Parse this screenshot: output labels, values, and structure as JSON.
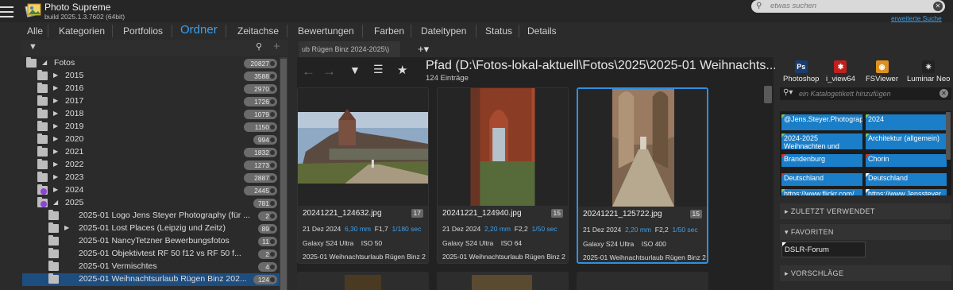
{
  "app": {
    "name": "Photo Supreme",
    "build": "build 2025.1.3.7602 (64bit)"
  },
  "search": {
    "placeholder": "etwas suchen",
    "advanced": "erweiterte Suche"
  },
  "tabs": [
    "Alle",
    "Kategorien",
    "Portfolios",
    "Ordner",
    "Zeitachse",
    "Bewertungen",
    "Farben",
    "Dateitypen",
    "Status",
    "Details"
  ],
  "active_tab": "Ordner",
  "tree": [
    {
      "label": "Fotos",
      "count": "20827",
      "level": 0,
      "expanded": true,
      "purple": false
    },
    {
      "label": "2015",
      "count": "3588",
      "level": 1,
      "expanded": false,
      "purple": false
    },
    {
      "label": "2016",
      "count": "2970",
      "level": 1,
      "expanded": false,
      "purple": false
    },
    {
      "label": "2017",
      "count": "1726",
      "level": 1,
      "expanded": false,
      "purple": false
    },
    {
      "label": "2018",
      "count": "1079",
      "level": 1,
      "expanded": false,
      "purple": false
    },
    {
      "label": "2019",
      "count": "1150",
      "level": 1,
      "expanded": false,
      "purple": false
    },
    {
      "label": "2020",
      "count": "994",
      "level": 1,
      "expanded": false,
      "purple": false
    },
    {
      "label": "2021",
      "count": "1832",
      "level": 1,
      "expanded": false,
      "purple": false
    },
    {
      "label": "2022",
      "count": "1273",
      "level": 1,
      "expanded": false,
      "purple": false
    },
    {
      "label": "2023",
      "count": "2887",
      "level": 1,
      "expanded": false,
      "purple": false
    },
    {
      "label": "2024",
      "count": "2445",
      "level": 1,
      "expanded": false,
      "purple": true
    },
    {
      "label": "2025",
      "count": "781",
      "level": 1,
      "expanded": true,
      "purple": true
    },
    {
      "label": "2025-01 Logo Jens Steyer Photography (für ...",
      "count": "2",
      "level": 2,
      "expanded": null,
      "purple": false
    },
    {
      "label": "2025-01 Lost Places (Leipzig und Zeitz)",
      "count": "89",
      "level": 2,
      "expanded": false,
      "purple": false
    },
    {
      "label": "2025-01 NancyTetzner Bewerbungsfotos",
      "count": "11",
      "level": 2,
      "expanded": null,
      "purple": false
    },
    {
      "label": "2025-01 Objektivtest RF 50 f12 vs RF 50 f...",
      "count": "2",
      "level": 2,
      "expanded": null,
      "purple": false
    },
    {
      "label": "2025-01 Vermischtes",
      "count": "4",
      "level": 2,
      "expanded": null,
      "purple": false
    },
    {
      "label": "2025-01 Weihnachtsurlaub Rügen Binz 202...",
      "count": "124",
      "level": 2,
      "expanded": null,
      "purple": false,
      "selected": true
    }
  ],
  "breadcrumb_tab": "ub Rügen Binz 2024-2025\\)",
  "path_title": "Pfad (D:\\Fotos-lokal-aktuell\\Fotos\\2025\\2025-01 Weihnachts...",
  "path_count": "124 Einträge",
  "cards": [
    {
      "filename": "20241221_124632.jpg",
      "badge": "17",
      "date": "21 Dez 2024",
      "focal": "6,30 mm",
      "aperture": "F1,7",
      "shutter": "1/180 sec",
      "camera": "Galaxy S24 Ultra",
      "iso": "ISO 50",
      "folder": "2025-01 Weihnachtsurlaub Rügen Binz 2"
    },
    {
      "filename": "20241221_124940.jpg",
      "badge": "15",
      "date": "21 Dez 2024",
      "focal": "2,20 mm",
      "aperture": "F2,2",
      "shutter": "1/50 sec",
      "camera": "Galaxy S24 Ultra",
      "iso": "ISO 64",
      "folder": "2025-01 Weihnachtsurlaub Rügen Binz 2"
    },
    {
      "filename": "20241221_125722.jpg",
      "badge": "15",
      "date": "21 Dez 2024",
      "focal": "2,20 mm",
      "aperture": "F2,2",
      "shutter": "1/50 sec",
      "camera": "Galaxy S24 Ultra",
      "iso": "ISO 400",
      "folder": "2025-01 Weihnachtsurlaub Rügen Binz 2"
    }
  ],
  "apps": [
    {
      "label": "Photoshop",
      "icon": "photoshop-icon",
      "color": "#1b3c6e",
      "glyph": "Ps"
    },
    {
      "label": "i_view64",
      "icon": "irfanview-icon",
      "color": "#c0201c",
      "glyph": "✱"
    },
    {
      "label": "FSViewer",
      "icon": "fsviewer-icon",
      "color": "#e09020",
      "glyph": "◉"
    },
    {
      "label": "Luminar Neo",
      "icon": "luminar-icon",
      "color": "#222",
      "glyph": "✳"
    }
  ],
  "tag_search": {
    "placeholder": "ein Katalogetikett hinzufügen"
  },
  "tags": [
    {
      "label": "@Jens.Steyer.Photography",
      "flag": "green"
    },
    {
      "label": "2024",
      "flag": "green"
    },
    {
      "label": "2024-2025 Weihnachten und",
      "flag": "green"
    },
    {
      "label": "Architektur (allgemein)",
      "flag": "green"
    },
    {
      "label": "Brandenburg",
      "flag": "red"
    },
    {
      "label": "Chorin",
      "flag": "red"
    },
    {
      "label": "Deutschland",
      "flag": "red"
    },
    {
      "label": "Deutschland",
      "flag": "white"
    },
    {
      "label": "https://www.flickr.com/",
      "flag": "green"
    },
    {
      "label": "https://www.Jenssteyer",
      "flag": "white"
    }
  ],
  "sections": {
    "recent": "ZULETZT VERWENDET",
    "favorites": "FAVORITEN",
    "suggestions": "VORSCHLÄGE"
  },
  "favorite_item": "DSLR-Forum"
}
